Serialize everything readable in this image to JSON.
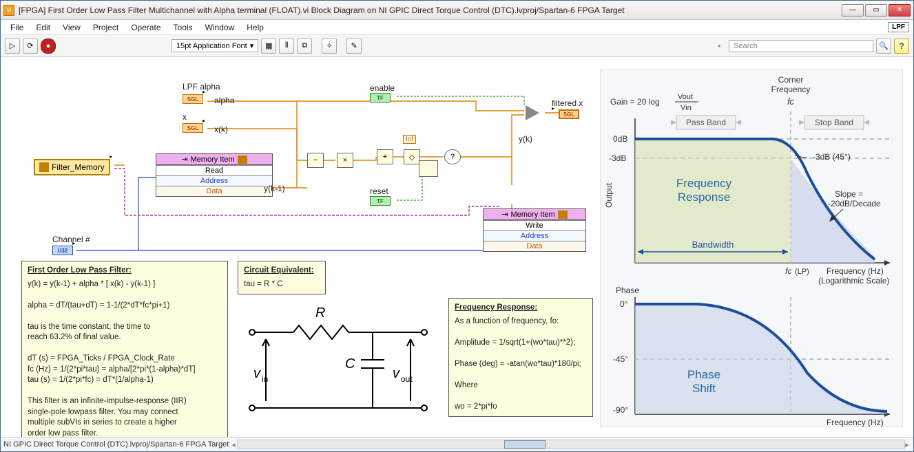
{
  "window_title": "[FPGA] First Order Low Pass Filter Multichannel with Alpha terminal (FLOAT).vi Block Diagram on NI GPIC Direct Torque Control (DTC).lvproj/Spartan-6 FPGA Target",
  "menubar": [
    "File",
    "Edit",
    "View",
    "Project",
    "Operate",
    "Tools",
    "Window",
    "Help"
  ],
  "lpf_chip": "LPF",
  "toolbar": {
    "font": "15pt Application Font",
    "search_placeholder": "Search"
  },
  "statusbar": "NI GPIC Direct Torque Control (DTC).lvproj/Spartan-6 FPGA Target",
  "labels": {
    "lpf_alpha": "LPF alpha",
    "alpha": "alpha",
    "x": "x",
    "xk": "x(k)",
    "ykm1": "y(k-1)",
    "enable": "enable",
    "reset": "reset",
    "filtered_x": "filtered x",
    "inf": "Inf",
    "yk": "y(k)",
    "channel": "Channel #",
    "filter_memory": "Filter_Memory"
  },
  "terminals": {
    "sgl": "SGL",
    "tf": "TF",
    "u32": "U32"
  },
  "memory_read": {
    "title": "Memory Item",
    "row1": "Read",
    "row2": "Address",
    "row3": "Data"
  },
  "memory_write": {
    "title": "Memory Item",
    "row1": "Write",
    "row2": "Address",
    "row3": "Data"
  },
  "chart_data": {
    "type": "line",
    "title_top": "Corner Frequency",
    "fc_label": "fc",
    "gain_expr": "Gain = 20 log",
    "vout": "Vout",
    "vin": "Vin",
    "passband": "Pass Band",
    "stopband": "Stop Band",
    "zero_db": "0dB",
    "minus3": "-3dB",
    "minus3_45": "-3dB (45°)",
    "freq_response": "Frequency Response",
    "slope": "Slope =\n -20dB/Decade",
    "bandwidth": "Bandwidth",
    "output_axis": "Output",
    "fc_lp": "fc (LP)",
    "x_axis": "Frequency (Hz)\n(Logarithmic Scale)",
    "phase_label": "Phase",
    "phase_shift": "Phase Shift",
    "phase_ticks": {
      "p0": "0°",
      "p45": "-45°",
      "p90": "-90°"
    },
    "freq_axis2": "Frequency (Hz)"
  },
  "note_filter": {
    "heading": "First Order Low Pass Filter:",
    "l1": "y(k) = y(k-1) + alpha * [ x(k) - y(k-1) ]",
    "l2": "alpha = dT/(tau+dT) = 1-1/(2*dT*fc*pi+1)",
    "l3": "tau is the time constant, the time to",
    "l3b": "reach 63.2% of final value.",
    "l4": "dT (s) = FPGA_Ticks / FPGA_Clock_Rate",
    "l5": "fc (Hz) = 1/(2*pi*tau) = alpha/[2*pi*(1-alpha)*dT]",
    "l6": "tau (s) = 1/(2*pi*fc) = dT*(1/alpha-1)",
    "l7": "This filter is an infinite-impulse-response (IIR)",
    "l8": "single-pole lowpass filter. You may connect",
    "l9": "multiple subVIs in series  to create a higher",
    "l10": "order low pass filter."
  },
  "note_circuit": {
    "heading": "Circuit Equivalent:",
    "l1": "tau = R * C"
  },
  "note_freq": {
    "heading": "Frequency Response:",
    "l1": "As a function of frequency, fo:",
    "l2": "Amplitude = 1/sqrt(1+(wo*tau)**2);",
    "l3": "Phase (deg) =  -atan(wo*tau)*180/pi;",
    "l4": "Where",
    "l5": "wo = 2*pi*fo"
  },
  "circuit": {
    "R": "R",
    "C": "C",
    "vin": "v",
    "vout": "v",
    "in_sub": "in",
    "out_sub": "out"
  }
}
